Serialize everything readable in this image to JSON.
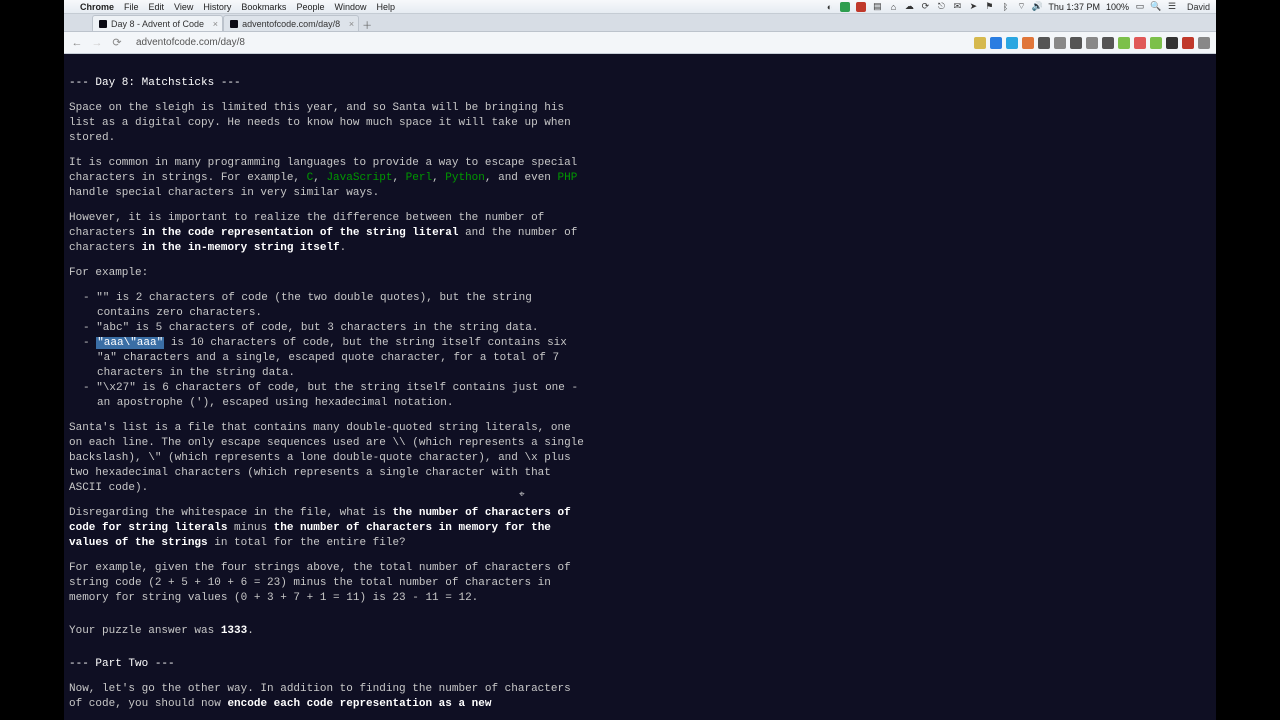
{
  "menubar": {
    "apple": "",
    "app": "Chrome",
    "items": [
      "File",
      "Edit",
      "View",
      "History",
      "Bookmarks",
      "People",
      "Window",
      "Help"
    ],
    "clock": "Thu 1:37 PM",
    "battery": "100%",
    "user": "David"
  },
  "tabs": [
    {
      "title": "Day 8 - Advent of Code",
      "active": true
    },
    {
      "title": "adventofcode.com/day/8",
      "active": false
    }
  ],
  "url": "adventofcode.com/day/8",
  "ext_colors": [
    "#d6b94e",
    "#2a7de1",
    "#2aa6e1",
    "#e0763a",
    "#555",
    "#888",
    "#555",
    "#888",
    "#555",
    "#7cc04b",
    "#e05858",
    "#7cc04b",
    "#333",
    "#c0392b",
    "#888"
  ],
  "article": {
    "title": "--- Day 8: Matchsticks ---",
    "p1": "Space on the sleigh is limited this year, and so Santa will be bringing his list as a digital copy. He needs to know how much space it will take up when stored.",
    "p2a": "It is common in many programming languages to provide a way to escape special characters in strings. For example, ",
    "langC": "C",
    "sep1": ", ",
    "langJS": "JavaScript",
    "sep2": ", ",
    "langPerl": "Perl",
    "sep3": ", ",
    "langPython": "Python",
    "p2b": ", and even ",
    "langPHP": "PHP",
    "p2c": " handle special characters in very similar ways.",
    "p3a": "However, it is important to realize the difference between the number of characters ",
    "p3em1": "in the code representation of the string literal",
    "p3b": " and the number of characters ",
    "p3em2": "in the in-memory string itself",
    "p3c": ".",
    "p4": "For example:",
    "li1": "\"\" is 2 characters of code (the two double quotes), but the string contains zero characters.",
    "li2": "\"abc\" is 5 characters of code, but 3 characters in the string data.",
    "li3sel": "\"aaa\\\"aaa\"",
    "li3rest": " is 10 characters of code, but the string itself contains six \"a\" characters and a single, escaped quote character, for a total of 7 characters in the string data.",
    "li4": "\"\\x27\" is 6 characters of code, but the string itself contains just one - an apostrophe ('), escaped using hexadecimal notation.",
    "p5": "Santa's list is a file that contains many double-quoted string literals, one on each line. The only escape sequences used are \\\\ (which represents a single backslash), \\\" (which represents a lone double-quote character), and \\x plus two hexadecimal characters (which represents a single character with that ASCII code).",
    "p6a": "Disregarding the whitespace in the file, what is ",
    "p6em1": "the number of characters of code for string literals",
    "p6b": " minus ",
    "p6em2": "the number of characters in memory for the values of the strings",
    "p6c": " in total for the entire file?",
    "p7": "For example, given the four strings above, the total number of characters of string code (2 + 5 + 10 + 6 = 23) minus the total number of characters in memory for string values (0 + 3 + 7 + 1 = 11) is 23 - 11 = 12.",
    "p8a": "Your puzzle answer was ",
    "p8ans": "1333",
    "p8b": ".",
    "part2": "--- Part Two ---",
    "p9a": "Now, let's go the other way. In addition to finding the number of characters of code, you should now ",
    "p9em": "encode each code representation as a new"
  }
}
